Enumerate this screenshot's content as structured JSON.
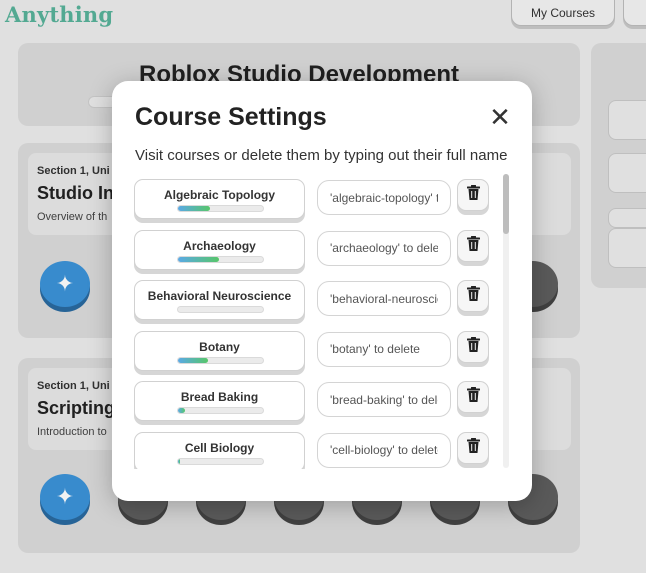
{
  "app": {
    "logo": "Anything",
    "nav": {
      "my_courses": "My Courses"
    }
  },
  "background": {
    "course_title": "Roblox Studio Development",
    "sections": [
      {
        "label": "Section 1, Uni",
        "title": "Studio Int",
        "desc": "Overview of th"
      },
      {
        "label": "Section 1, Uni",
        "title": "Scripting",
        "desc": "Introduction to"
      }
    ]
  },
  "modal": {
    "title": "Course Settings",
    "close_icon": "close-icon",
    "subtitle": "Visit courses or delete them by typing out their full name",
    "courses": [
      {
        "name": "Algebraic Topology",
        "placeholder": "'algebraic-topology' to delete",
        "progress": 0.38
      },
      {
        "name": "Archaeology",
        "placeholder": "'archaeology' to delete",
        "progress": 0.48
      },
      {
        "name": "Behavioral Neuroscience",
        "placeholder": "'behavioral-neuroscience' to delete",
        "progress": 0.0
      },
      {
        "name": "Botany",
        "placeholder": "'botany' to delete",
        "progress": 0.35
      },
      {
        "name": "Bread Baking",
        "placeholder": "'bread-baking' to delete",
        "progress": 0.08
      },
      {
        "name": "Cell Biology",
        "placeholder": "'cell-biology' to delete",
        "progress": 0.02
      }
    ],
    "delete_icon": "trash-icon"
  },
  "colors": {
    "accent": "#3b93d9",
    "logo": "#58b39a",
    "progress_start": "#5aa9e6",
    "progress_end": "#57c66a"
  }
}
